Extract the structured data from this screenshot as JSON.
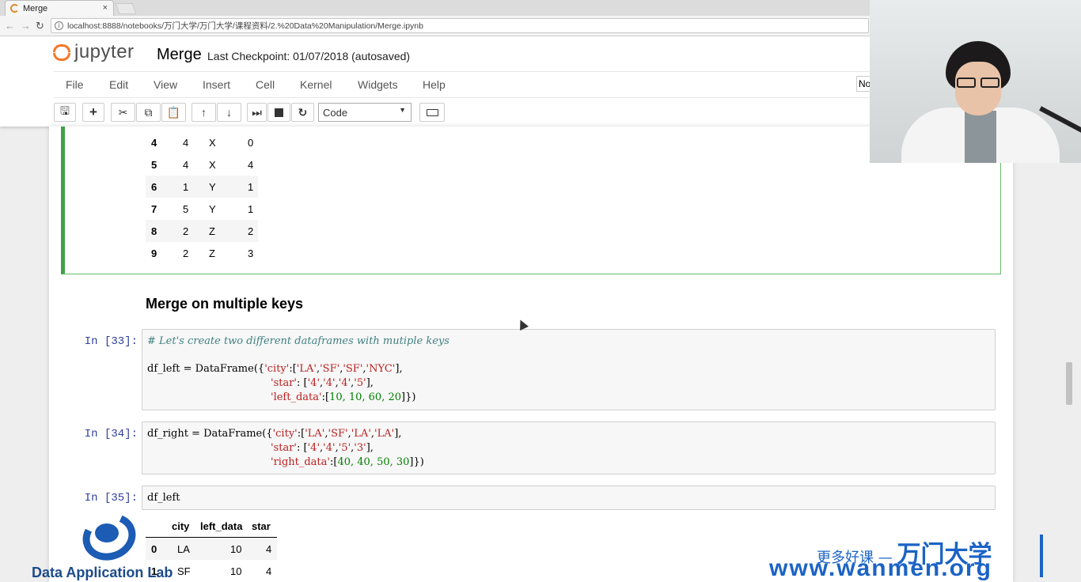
{
  "browser": {
    "tab_title": "Merge",
    "tab_close": "×",
    "url": "localhost:8888/notebooks/万门大学/万门大学/课程资料/2.%20Data%20Manipulation/Merge.ipynb",
    "info_symbol": "i"
  },
  "header": {
    "logo_text": "jupyter",
    "notebook_name": "Merge",
    "checkpoint": "Last Checkpoint: 01/07/2018 (autosaved)",
    "kernel_badge": "No"
  },
  "menu": [
    "File",
    "Edit",
    "View",
    "Insert",
    "Cell",
    "Kernel",
    "Widgets",
    "Help"
  ],
  "toolbar": {
    "cell_type": "Code"
  },
  "prev_output_rows": [
    {
      "idx": "4",
      "a": "4",
      "b": "X",
      "c": "0"
    },
    {
      "idx": "5",
      "a": "4",
      "b": "X",
      "c": "4"
    },
    {
      "idx": "6",
      "a": "1",
      "b": "Y",
      "c": "1"
    },
    {
      "idx": "7",
      "a": "5",
      "b": "Y",
      "c": "1"
    },
    {
      "idx": "8",
      "a": "2",
      "b": "Z",
      "c": "2"
    },
    {
      "idx": "9",
      "a": "2",
      "b": "Z",
      "c": "3"
    }
  ],
  "heading": "Merge on multiple keys",
  "cells": {
    "c33": {
      "prompt": "In [33]:",
      "comment": "# Let's create two different dataframes with mutiple keys",
      "line2_pre": "df_left = DataFrame({",
      "line2_s1": "'city'",
      "line2_mid": ":[",
      "line2_s2": "'LA'",
      "line2_s3": "'SF'",
      "line2_s4": "'SF'",
      "line2_s5": "'NYC'",
      "line3_s1": "'star'",
      "line3_s2": "'4'",
      "line3_s3": "'4'",
      "line3_s4": "'4'",
      "line3_s5": "'5'",
      "line4_s1": "'left_data'",
      "line4_n": "10, 10, 60, 20"
    },
    "c34": {
      "prompt": "In [34]:",
      "line1_pre": "df_right = DataFrame({",
      "line1_s1": "'city'",
      "line1_s2": "'LA'",
      "line1_s3": "'SF'",
      "line1_s4": "'LA'",
      "line1_s5": "'LA'",
      "line2_s1": "'star'",
      "line2_s2": "'4'",
      "line2_s3": "'4'",
      "line2_s4": "'5'",
      "line2_s5": "'3'",
      "line3_s1": "'right_data'",
      "line3_n": "40, 40, 50, 30"
    },
    "c35": {
      "prompt": "In [35]:",
      "code": "df_left"
    }
  },
  "df_left_output": {
    "headers": [
      "city",
      "left_data",
      "star"
    ],
    "rows": [
      {
        "idx": "0",
        "city": "LA",
        "left_data": "10",
        "star": "4"
      },
      {
        "idx": "1",
        "city": "SF",
        "left_data": "10",
        "star": "4"
      }
    ]
  },
  "watermarks": {
    "left": "Data Application Lab",
    "right_line1": "更多好课 —",
    "right_brand": "万门大学",
    "right_url": "www.wanmen.org"
  }
}
